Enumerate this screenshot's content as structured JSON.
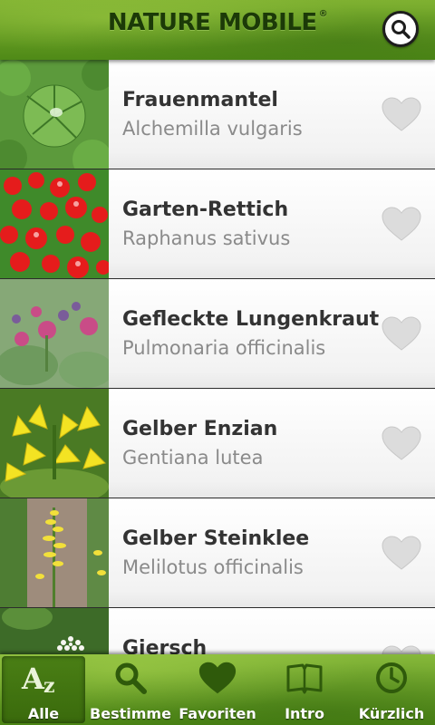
{
  "header": {
    "logo": "NATURE MOBILE",
    "logo_mark": "®",
    "search_icon": "search-icon"
  },
  "plants": [
    {
      "common": "Frauenmantel",
      "latin": "Alchemilla vulgaris",
      "favorite": false
    },
    {
      "common": "Garten-Rettich",
      "latin": "Raphanus sativus",
      "favorite": false
    },
    {
      "common": "Gefleckte Lungenkraut",
      "latin": "Pulmonaria officinalis",
      "favorite": false
    },
    {
      "common": "Gelber Enzian",
      "latin": "Gentiana lutea",
      "favorite": false
    },
    {
      "common": "Gelber Steinklee",
      "latin": "Melilotus officinalis",
      "favorite": false
    },
    {
      "common": "Giersch",
      "latin": "",
      "favorite": false
    }
  ],
  "tabs": [
    {
      "label": "Alle",
      "icon": "az-icon",
      "active": true
    },
    {
      "label": "Bestimme",
      "icon": "magnifier-icon",
      "active": false
    },
    {
      "label": "Favoriten",
      "icon": "heart-icon",
      "active": false
    },
    {
      "label": "Intro",
      "icon": "book-icon",
      "active": false
    },
    {
      "label": "Kürzlich",
      "icon": "clock-icon",
      "active": false
    }
  ],
  "colors": {
    "brand_green": "#5a941d",
    "title_text": "#333333",
    "subtitle_text": "#8a8a8a",
    "heart_gray": "#d9d9d9"
  }
}
